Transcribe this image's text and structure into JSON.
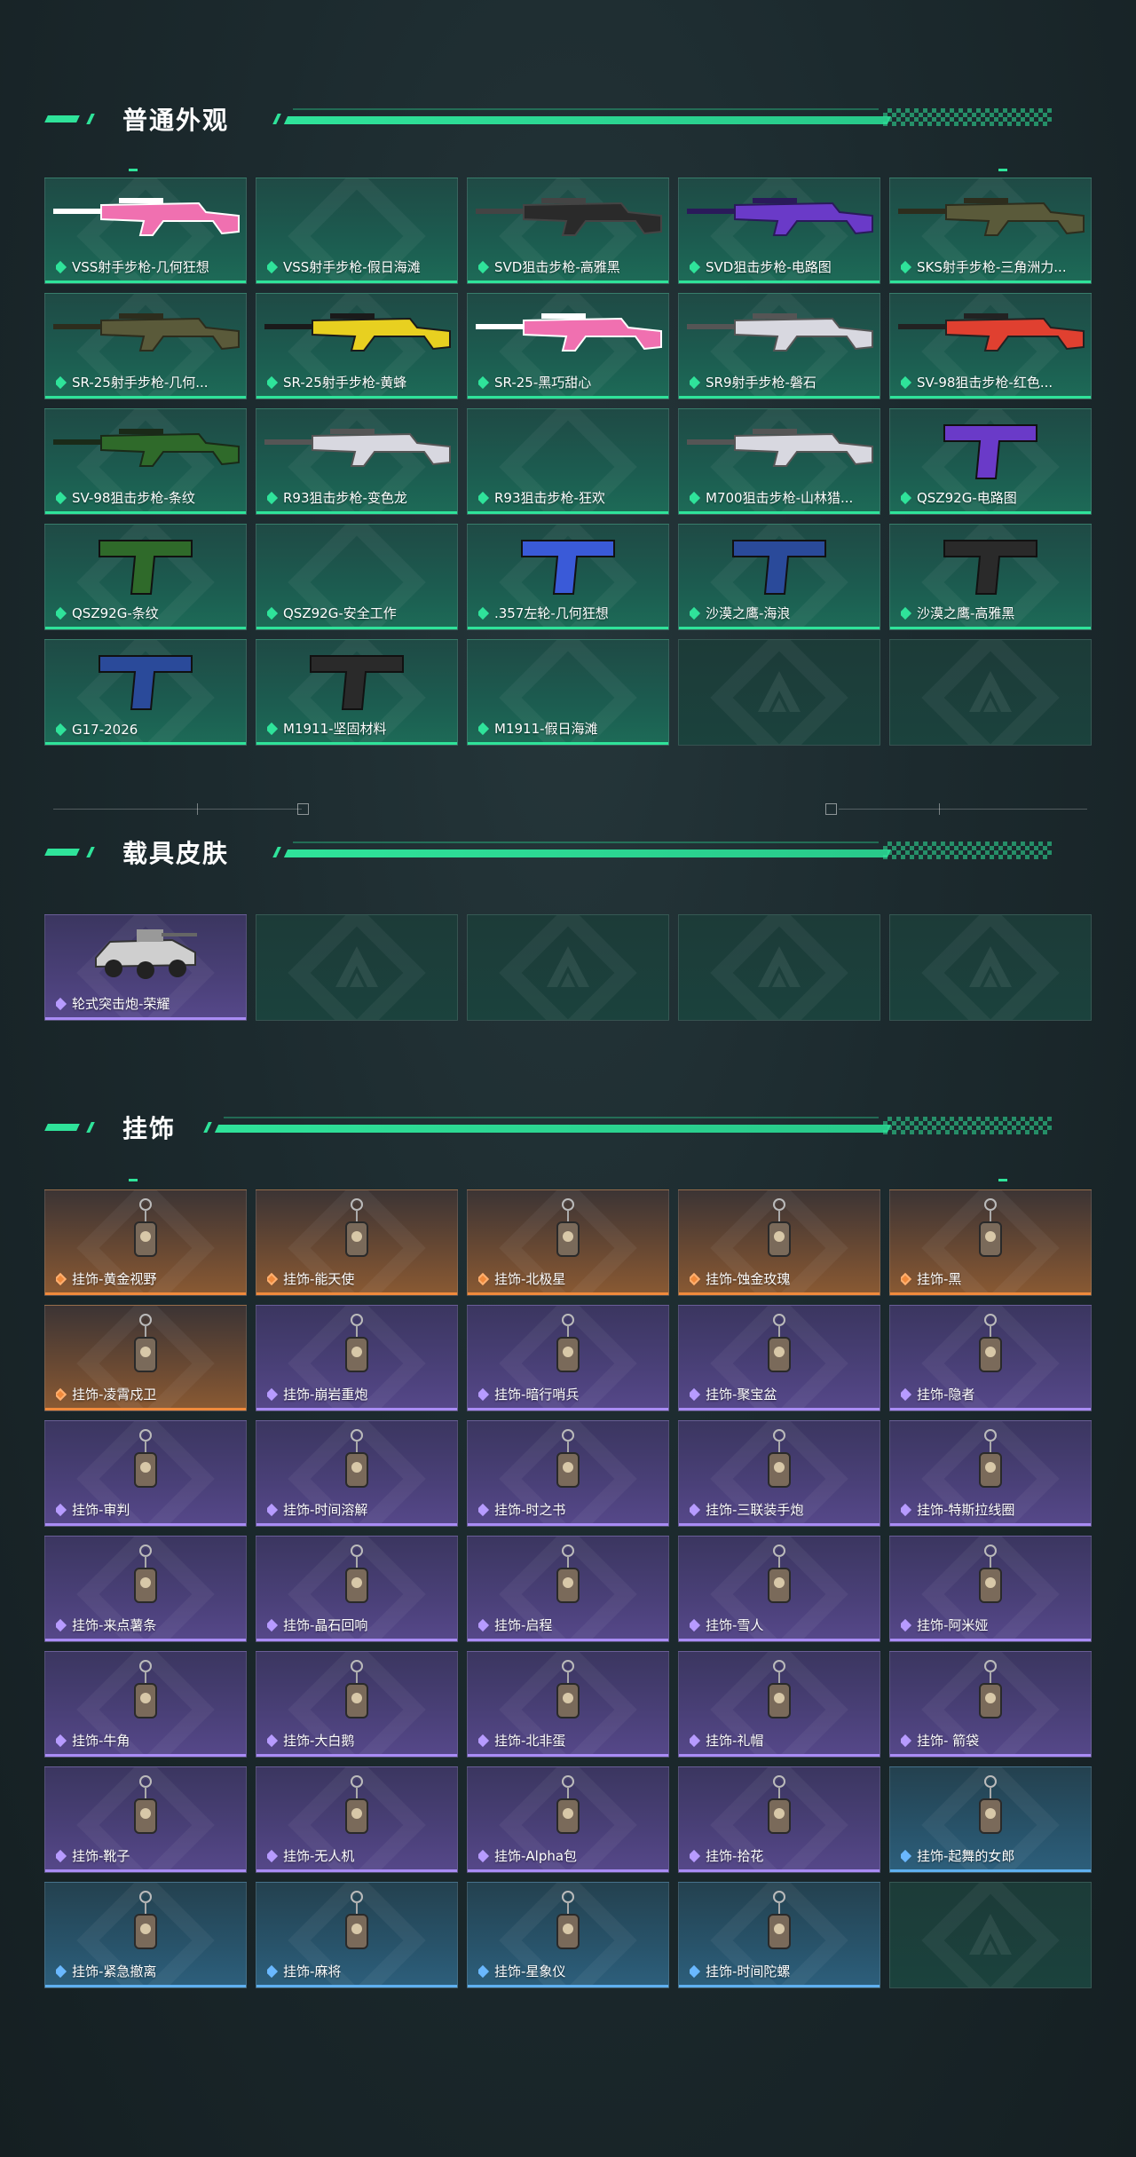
{
  "sections": {
    "weapons": {
      "title": "普通外观",
      "items": [
        {
          "label": "VSS射手步枪-几何狂想",
          "rarity": "green",
          "icon": "rifle-pink-icon"
        },
        {
          "label": "VSS射手步枪-假日海滩",
          "rarity": "green",
          "icon": ""
        },
        {
          "label": "SVD狙击步枪-高雅黑",
          "rarity": "green",
          "icon": "rifle-black-icon"
        },
        {
          "label": "SVD狙击步枪-电路图",
          "rarity": "green",
          "icon": "rifle-purple-icon"
        },
        {
          "label": "SKS射手步枪-三角洲力...",
          "rarity": "green",
          "icon": "rifle-camo-icon"
        },
        {
          "label": "SR-25射手步枪-几何...",
          "rarity": "green",
          "icon": "rifle-camo-icon"
        },
        {
          "label": "SR-25射手步枪-黄蜂",
          "rarity": "green",
          "icon": "rifle-yellow-icon"
        },
        {
          "label": "SR-25-黑巧甜心",
          "rarity": "green",
          "icon": "rifle-pink-icon"
        },
        {
          "label": "SR9射手步枪-磐石",
          "rarity": "green",
          "icon": "rifle-white-icon"
        },
        {
          "label": "SV-98狙击步枪-红色...",
          "rarity": "green",
          "icon": "rifle-red-icon"
        },
        {
          "label": "SV-98狙击步枪-条纹",
          "rarity": "green",
          "icon": "rifle-green-icon"
        },
        {
          "label": "R93狙击步枪-变色龙",
          "rarity": "green",
          "icon": "rifle-white-icon"
        },
        {
          "label": "R93狙击步枪-狂欢",
          "rarity": "green",
          "icon": ""
        },
        {
          "label": "M700狙击步枪-山林猎...",
          "rarity": "green",
          "icon": "rifle-white-icon"
        },
        {
          "label": "QSZ92G-电路图",
          "rarity": "green",
          "icon": "pistol-purple-icon"
        },
        {
          "label": "QSZ92G-条纹",
          "rarity": "green",
          "icon": "pistol-green-icon"
        },
        {
          "label": "QSZ92G-安全工作",
          "rarity": "green",
          "icon": ""
        },
        {
          "label": ".357左轮-几何狂想",
          "rarity": "green",
          "icon": "revolver-icon"
        },
        {
          "label": "沙漠之鹰-海浪",
          "rarity": "green",
          "icon": "pistol-blue-icon"
        },
        {
          "label": "沙漠之鹰-高雅黑",
          "rarity": "green",
          "icon": "pistol-black-icon"
        },
        {
          "label": "G17-2026",
          "rarity": "green",
          "icon": "pistol-blue-icon"
        },
        {
          "label": "M1911-坚固材料",
          "rarity": "green",
          "icon": "pistol-black-icon"
        },
        {
          "label": "M1911-假日海滩",
          "rarity": "green",
          "icon": ""
        },
        {
          "label": "",
          "rarity": "empty",
          "icon": "logo-placeholder-icon"
        },
        {
          "label": "",
          "rarity": "empty",
          "icon": "logo-placeholder-icon"
        }
      ]
    },
    "vehicles": {
      "title": "载具皮肤",
      "items": [
        {
          "label": "轮式突击炮-荣耀",
          "rarity": "purple",
          "icon": "vehicle-icon"
        },
        {
          "label": "",
          "rarity": "empty",
          "icon": "logo-placeholder-icon"
        },
        {
          "label": "",
          "rarity": "empty",
          "icon": "logo-placeholder-icon"
        },
        {
          "label": "",
          "rarity": "empty",
          "icon": "logo-placeholder-icon"
        },
        {
          "label": "",
          "rarity": "empty",
          "icon": "logo-placeholder-icon"
        }
      ]
    },
    "charms": {
      "title": "挂饰",
      "items": [
        {
          "label": "挂饰-黄金视野",
          "rarity": "orange",
          "icon": "charm-icon"
        },
        {
          "label": "挂饰-能天使",
          "rarity": "orange",
          "icon": "charm-icon"
        },
        {
          "label": "挂饰-北极星",
          "rarity": "orange",
          "icon": "charm-icon"
        },
        {
          "label": "挂饰-蚀金玫瑰",
          "rarity": "orange",
          "icon": "charm-icon"
        },
        {
          "label": "挂饰-黑",
          "rarity": "orange",
          "icon": "charm-icon"
        },
        {
          "label": "挂饰-凌霄戍卫",
          "rarity": "orange",
          "icon": "charm-icon"
        },
        {
          "label": "挂饰-崩岩重炮",
          "rarity": "purple",
          "icon": "charm-icon"
        },
        {
          "label": "挂饰-暗行哨兵",
          "rarity": "purple",
          "icon": "charm-icon"
        },
        {
          "label": "挂饰-聚宝盆",
          "rarity": "purple",
          "icon": "charm-icon"
        },
        {
          "label": "挂饰-隐者",
          "rarity": "purple",
          "icon": "charm-icon"
        },
        {
          "label": "挂饰-审判",
          "rarity": "purple",
          "icon": "charm-icon"
        },
        {
          "label": "挂饰-时间溶解",
          "rarity": "purple",
          "icon": "charm-icon"
        },
        {
          "label": "挂饰-时之书",
          "rarity": "purple",
          "icon": "charm-icon"
        },
        {
          "label": "挂饰-三联装手炮",
          "rarity": "purple",
          "icon": "charm-icon"
        },
        {
          "label": "挂饰-特斯拉线圈",
          "rarity": "purple",
          "icon": "charm-icon"
        },
        {
          "label": "挂饰-来点薯条",
          "rarity": "purple",
          "icon": "charm-icon"
        },
        {
          "label": "挂饰-晶石回响",
          "rarity": "purple",
          "icon": "charm-icon"
        },
        {
          "label": "挂饰-启程",
          "rarity": "purple",
          "icon": "charm-icon"
        },
        {
          "label": "挂饰-雪人",
          "rarity": "purple",
          "icon": "charm-icon"
        },
        {
          "label": "挂饰-阿米娅",
          "rarity": "purple",
          "icon": "charm-icon"
        },
        {
          "label": "挂饰-牛角",
          "rarity": "purple",
          "icon": "charm-icon"
        },
        {
          "label": "挂饰-大白鹅",
          "rarity": "purple",
          "icon": "charm-icon"
        },
        {
          "label": "挂饰-北非蛋",
          "rarity": "purple",
          "icon": "charm-icon"
        },
        {
          "label": "挂饰-礼帽",
          "rarity": "purple",
          "icon": "charm-icon"
        },
        {
          "label": "挂饰- 箭袋",
          "rarity": "purple",
          "icon": "charm-icon"
        },
        {
          "label": "挂饰-靴子",
          "rarity": "purple",
          "icon": "charm-icon"
        },
        {
          "label": "挂饰-无人机",
          "rarity": "purple",
          "icon": "charm-icon"
        },
        {
          "label": "挂饰-Alpha包",
          "rarity": "purple",
          "icon": "charm-icon"
        },
        {
          "label": "挂饰-拾花",
          "rarity": "purple",
          "icon": "charm-icon"
        },
        {
          "label": "挂饰-起舞的女郎",
          "rarity": "blue",
          "icon": "charm-icon"
        },
        {
          "label": "挂饰-紧急撤离",
          "rarity": "blue",
          "icon": "charm-icon"
        },
        {
          "label": "挂饰-麻将",
          "rarity": "blue",
          "icon": "charm-icon"
        },
        {
          "label": "挂饰-星象仪",
          "rarity": "blue",
          "icon": "charm-icon"
        },
        {
          "label": "挂饰-时间陀螺",
          "rarity": "blue",
          "icon": "charm-icon"
        },
        {
          "label": "",
          "rarity": "empty",
          "icon": "logo-placeholder-icon"
        }
      ]
    }
  },
  "colors": {
    "accent": "#2fe39a",
    "green": "#2fe39a",
    "purple": "#a98cf5",
    "orange": "#f08a3c",
    "blue": "#5fb0f0"
  }
}
